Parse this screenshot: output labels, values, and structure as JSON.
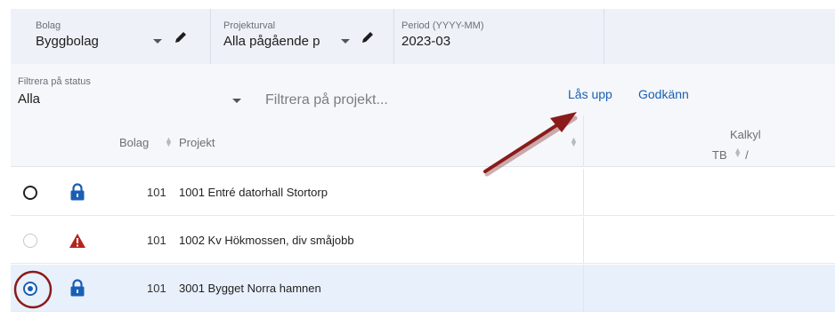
{
  "selectors": {
    "bolag": {
      "label": "Bolag",
      "value": "Byggbolag"
    },
    "projekturval": {
      "label": "Projekturval",
      "value": "Alla pågående p"
    },
    "period": {
      "label": "Period (YYYY-MM)",
      "value": "2023-03"
    }
  },
  "filter": {
    "status_label": "Filtrera på status",
    "status_value": "Alla",
    "project_placeholder": "Filtrera på projekt...",
    "unlock_label": "Lås upp",
    "approve_label": "Godkänn"
  },
  "table": {
    "columns": {
      "bolag": "Bolag",
      "projekt": "Projekt",
      "kalkyl": "Kalkyl",
      "tb": "TB",
      "tb_suffix": "/"
    },
    "rows": [
      {
        "bolag": "101",
        "projekt": "1001 Entré datorhall Stortorp",
        "status_icon": "lock-icon",
        "radio": "unchecked",
        "selected": false
      },
      {
        "bolag": "101",
        "projekt": "1002 Kv Hökmossen, div småjobb",
        "status_icon": "warning-icon",
        "radio": "disabled",
        "selected": false
      },
      {
        "bolag": "101",
        "projekt": "3001 Bygget Norra hamnen",
        "status_icon": "lock-icon",
        "radio": "checked",
        "selected": true
      }
    ]
  },
  "colors": {
    "accent": "#1a5fb4",
    "warning": "#b3261e",
    "annotation": "#8b1a1a",
    "selected_row": "#e8f0fb"
  }
}
